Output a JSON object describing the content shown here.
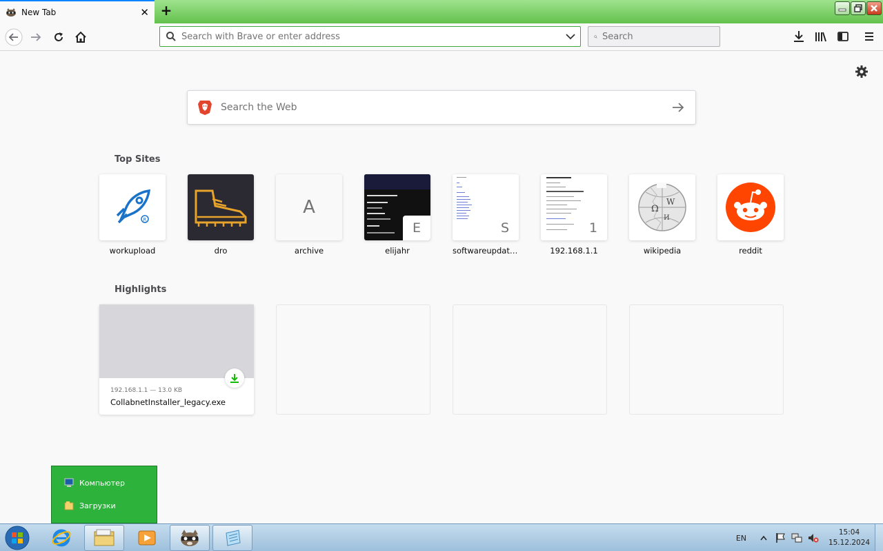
{
  "tab": {
    "title": "New Tab",
    "favicon": "raccoon-icon",
    "close_icon": "close-icon"
  },
  "window_controls": [
    "minimize-icon",
    "restore-icon",
    "close-icon"
  ],
  "navbar": {
    "url_placeholder": "Search with Brave or enter address",
    "search_placeholder": "Search",
    "icons": [
      "back-icon",
      "forward-icon",
      "reload-icon",
      "home-icon",
      "downloads-icon",
      "library-icon",
      "sidebar-icon",
      "menu-icon"
    ],
    "accent": "#3aa83a"
  },
  "newtab": {
    "web_search_placeholder": "Search the Web",
    "top_sites_title": "Top Sites",
    "top_sites": [
      {
        "label": "workupload",
        "icon": "rocket-logo-icon"
      },
      {
        "label": "dro",
        "icon": "boot-logo-icon"
      },
      {
        "label": "archive",
        "letter": "A"
      },
      {
        "label": "elijahr",
        "letter": "E"
      },
      {
        "label": "softwareupdate....",
        "letter": "S"
      },
      {
        "label": "192.168.1.1",
        "letter": "1"
      },
      {
        "label": "wikipedia",
        "icon": "wikipedia-globe-icon"
      },
      {
        "label": "reddit",
        "icon": "reddit-alien-icon"
      }
    ],
    "highlights_title": "Highlights",
    "highlights": [
      {
        "meta": "192.168.1.1 — 13.0 KB",
        "filename": "CollabnetInstaller_legacy.exe"
      }
    ]
  },
  "jumplist": {
    "items": [
      "Компьютер",
      "Загрузки"
    ]
  },
  "taskbar": {
    "apps": [
      "internet-explorer-icon",
      "file-explorer-icon",
      "media-player-icon",
      "browser-raccoon-icon",
      "notepad-icon"
    ],
    "language": "EN",
    "time": "15:04",
    "date": "15.12.2024"
  }
}
